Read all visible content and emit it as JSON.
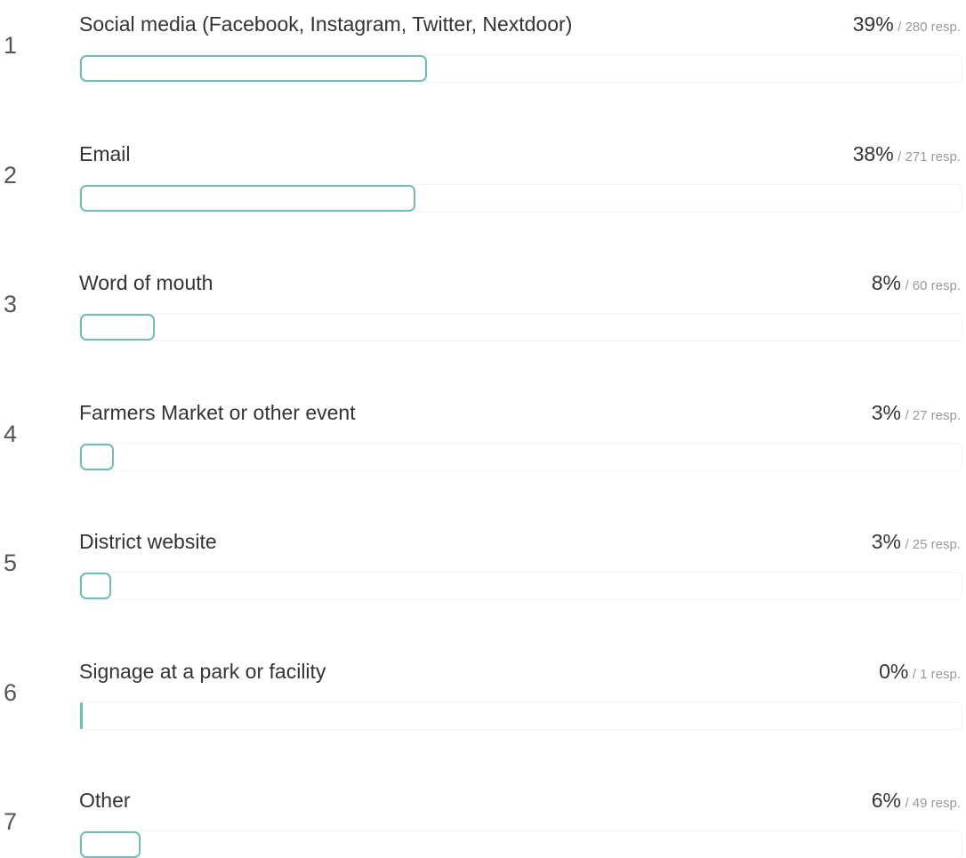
{
  "colors": {
    "bar_border": "#72bcb7",
    "track_border": "#f1f3f4",
    "text": "#333333",
    "muted": "#999999"
  },
  "resp_suffix": " resp.",
  "chart_data": {
    "type": "bar",
    "orientation": "horizontal",
    "grid": false,
    "legend": "none",
    "xlim": [
      0,
      100
    ],
    "items": [
      {
        "rank": "1",
        "label": "Social media (Facebook, Instagram, Twitter, Nextdoor)",
        "percent_label": "39%",
        "percent": 39,
        "responses": 280,
        "responses_label": "/ 280 resp."
      },
      {
        "rank": "2",
        "label": "Email",
        "percent_label": "38%",
        "percent": 38,
        "responses": 271,
        "responses_label": "/ 271 resp."
      },
      {
        "rank": "3",
        "label": "Word of mouth",
        "percent_label": "8%",
        "percent": 8,
        "responses": 60,
        "responses_label": "/ 60 resp."
      },
      {
        "rank": "4",
        "label": "Farmers Market or other event",
        "percent_label": "3%",
        "percent": 3,
        "responses": 27,
        "responses_label": "/ 27 resp."
      },
      {
        "rank": "5",
        "label": "District website",
        "percent_label": "3%",
        "percent": 3,
        "responses": 25,
        "responses_label": "/ 25 resp."
      },
      {
        "rank": "6",
        "label": "Signage at a park or facility",
        "percent_label": "0%",
        "percent": 0,
        "responses": 1,
        "responses_label": "/ 1 resp."
      },
      {
        "rank": "7",
        "label": "Other",
        "percent_label": "6%",
        "percent": 6,
        "responses": 49,
        "responses_label": "/ 49 resp."
      }
    ]
  }
}
